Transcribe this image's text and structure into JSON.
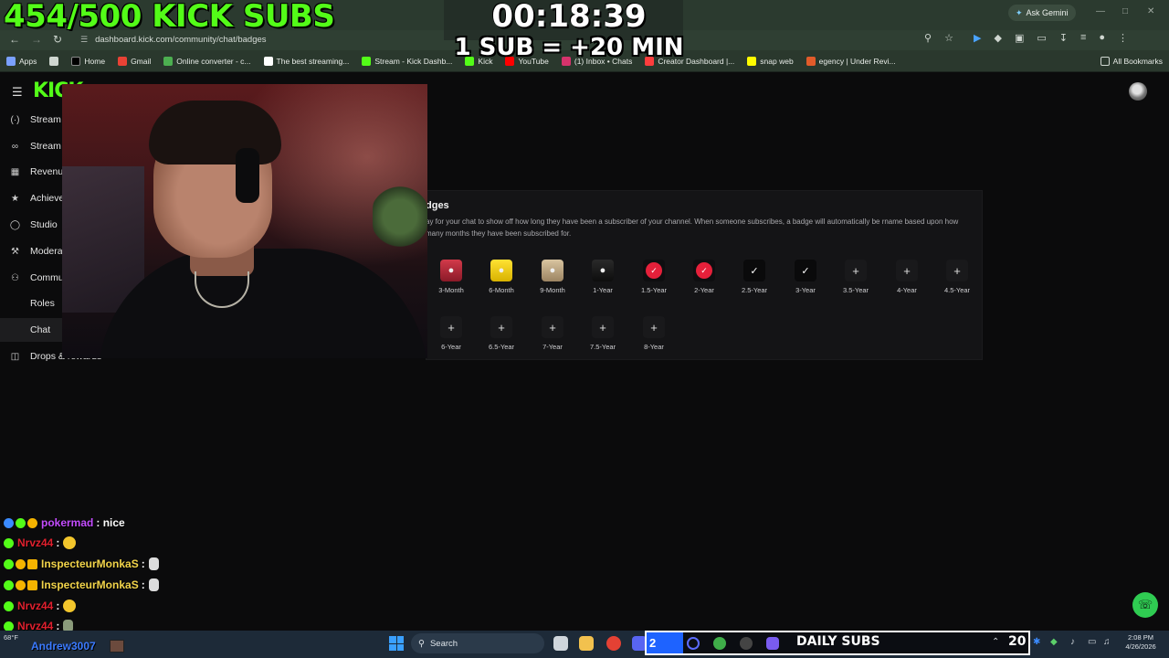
{
  "overlay": {
    "subs_progress": "454/500 KICK SUBS",
    "timer": "00:18:39",
    "rule": "1 SUB = +20 MIN"
  },
  "browser": {
    "url": "dashboard.kick.com/community/chat/badges",
    "gemini_label": "Ask Gemini",
    "bookmarks": [
      "Apps",
      "Home",
      "Gmail",
      "Online converter - c...",
      "The best streaming...",
      "Stream - Kick Dashb...",
      "Kick",
      "YouTube",
      "(1) Inbox • Chats",
      "Creator Dashboard |...",
      "snap web",
      "egency | Under Revi..."
    ],
    "all_bookmarks": "All Bookmarks"
  },
  "dashboard": {
    "logo": "KICK",
    "sidebar": [
      "Stream",
      "Stream",
      "Revenue",
      "Achieve",
      "Studio",
      "Modera",
      "Commu",
      "Roles",
      "Chat",
      "Drops & rewards"
    ]
  },
  "badges_panel": {
    "title": "dges",
    "description": "ay for your chat to show off how long they have been a subscriber of your channel. When someone subscribes, a badge will automatically be rname based upon how many months they have been subscribed for.",
    "row1": [
      "3-Month",
      "6-Month",
      "9-Month",
      "1-Year",
      "1.5-Year",
      "2-Year",
      "2.5-Year",
      "3-Year",
      "3.5-Year",
      "4-Year",
      "4.5-Year"
    ],
    "row2": [
      "6-Year",
      "6.5-Year",
      "7-Year",
      "7.5-Year",
      "8-Year"
    ]
  },
  "chat": [
    {
      "user": "pokermad",
      "color": "#c44dff",
      "msg": ": nice"
    },
    {
      "user": "Nrvz44",
      "color": "#e0202e",
      "msg": ":"
    },
    {
      "user": "InspecteurMonkaS",
      "color": "#f2d44a",
      "msg": ":"
    },
    {
      "user": "InspecteurMonkaS",
      "color": "#f2d44a",
      "msg": ":"
    },
    {
      "user": "Nrvz44",
      "color": "#e0202e",
      "msg": ":"
    },
    {
      "user": "Nrvz44",
      "color": "#e0202e",
      "msg": ":"
    }
  ],
  "taskbar": {
    "weather": "68°F",
    "chat_user": "Andrew3007",
    "search": "Search",
    "daily_subs_count": "2",
    "daily_subs_label": "DAILY SUBS",
    "daily_subs_goal": "20",
    "time": "2:08 PM",
    "date": "4/26/2026"
  },
  "colors": {
    "kick_green": "#53fc18",
    "accent_blue": "#1e63ff"
  }
}
